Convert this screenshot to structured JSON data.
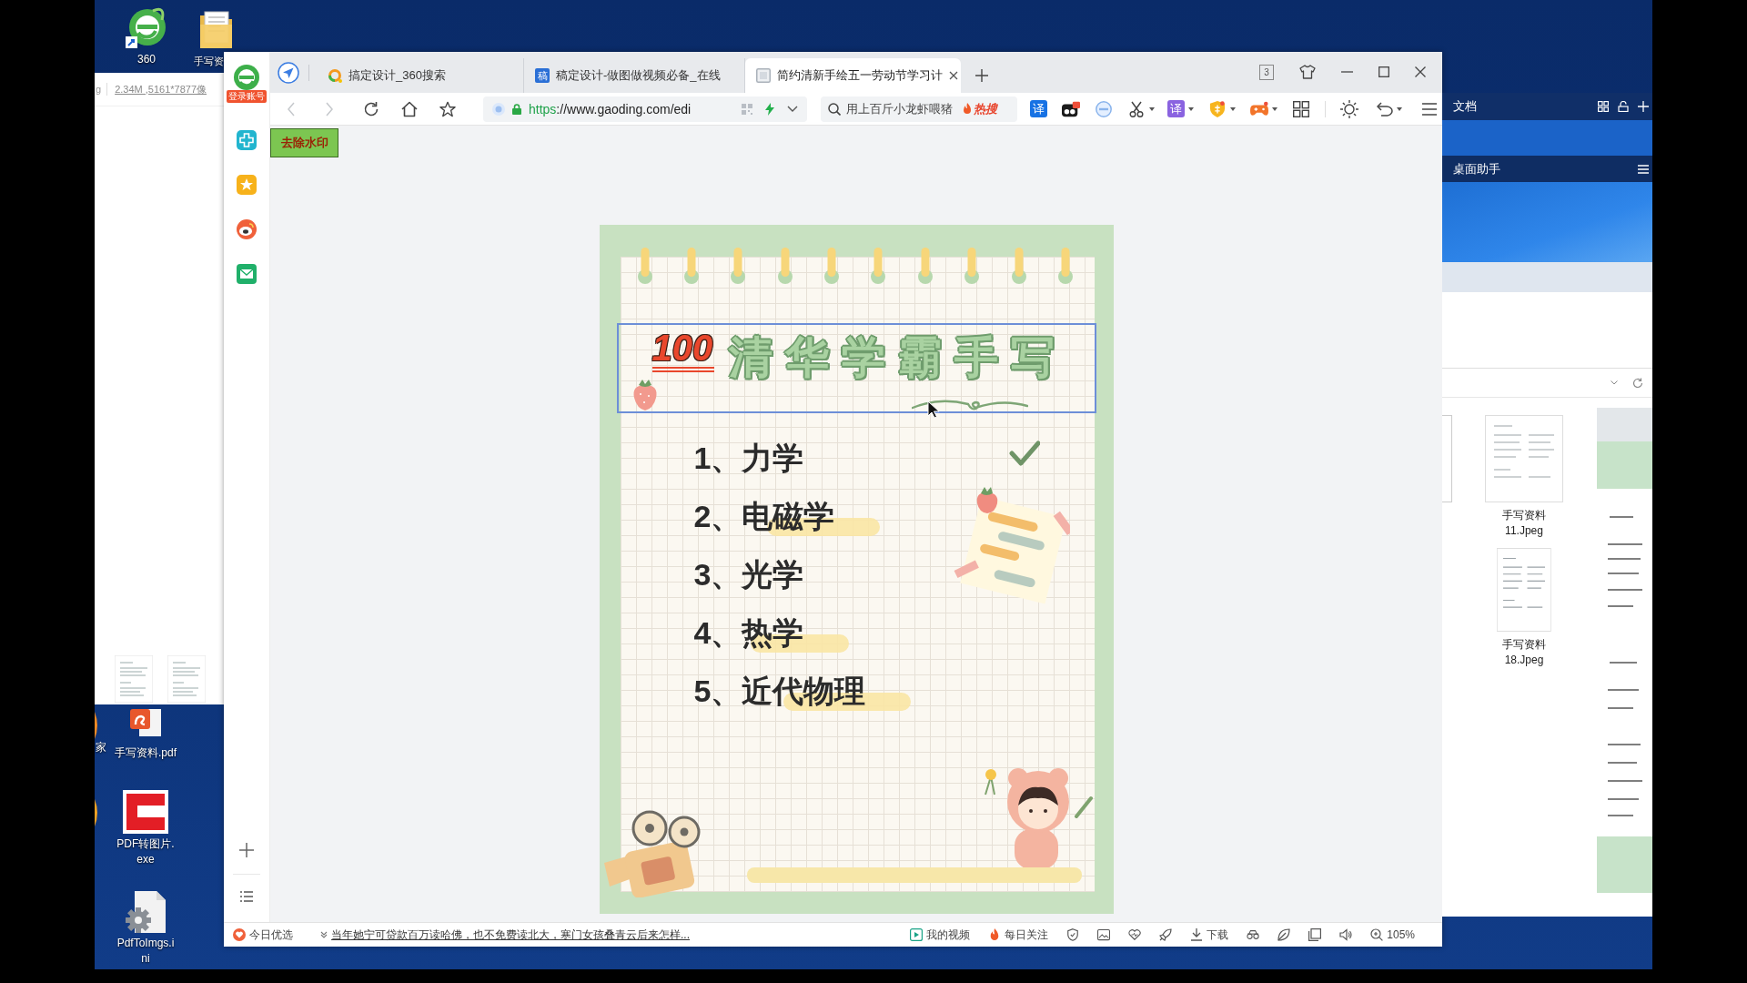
{
  "desktop": {
    "top_icons": [
      {
        "label": "360",
        "kind": "browser"
      },
      {
        "label": "手写资",
        "kind": "folder"
      }
    ],
    "bottom_icons": [
      {
        "label": "手写资料.pdf",
        "kind": "pdf"
      },
      {
        "label": "PDF转图片.exe",
        "kind": "exe"
      },
      {
        "label": "PdfToImgs.ini",
        "kind": "ini"
      }
    ],
    "edge_label": "家"
  },
  "viewer_window": {
    "path_fragment": "g",
    "file_info": "2.34M ,5161*7877像"
  },
  "browser": {
    "login_badge": "登录账号",
    "tabs": [
      {
        "title": "搞定设计_360搜索",
        "kind": "search",
        "selected": false
      },
      {
        "title": "稿定设计-做图做视频必备_在线",
        "kind": "site",
        "logo_text": "稿",
        "selected": false
      },
      {
        "title": "简约清新手绘五一劳动节学习计",
        "kind": "page",
        "selected": true
      }
    ],
    "tab_count": "3",
    "nav": {
      "back_disabled": true,
      "forward_disabled": true
    },
    "address": {
      "scheme": "https",
      "rest": "://www.gaoding.com/edi"
    },
    "search": {
      "placeholder": "用上百斤小龙虾喂猪",
      "hot_label": "热搜"
    },
    "extensions": [
      {
        "kind": "translate",
        "label": "译",
        "dropdown": false
      },
      {
        "kind": "mask",
        "dropdown": false
      },
      {
        "kind": "blocker",
        "dropdown": false
      },
      {
        "kind": "scissors",
        "dropdown": true
      },
      {
        "kind": "translate-alt",
        "label": "译",
        "dropdown": true
      },
      {
        "kind": "shield",
        "dropdown": true
      },
      {
        "kind": "gamepad",
        "dropdown": true
      },
      {
        "kind": "grid",
        "dropdown": false
      }
    ],
    "watermark_button": "去除水印",
    "poster": {
      "badge": "100",
      "title": "清华学霸手写",
      "title_selected": true,
      "items": [
        {
          "text": "1、力学",
          "checked": true,
          "highlight": false
        },
        {
          "text": "2、电磁学",
          "checked": false,
          "highlight": true
        },
        {
          "text": "3、光学",
          "checked": false,
          "highlight": false
        },
        {
          "text": "4、热学",
          "checked": false,
          "highlight": true
        },
        {
          "text": "5、近代物理",
          "checked": false,
          "highlight": true
        }
      ]
    },
    "status_bar": {
      "left_label": "今日优选",
      "headline": "当年她宁可贷款百万读哈佛，也不免费读北大，寒门女孩叠青云后来怎样...",
      "video_label": "我的视频",
      "follow_label": "每日关注",
      "download_label": "下载",
      "zoom": "105%"
    }
  },
  "side_window": {
    "title": "文档",
    "panel_title": "桌面助手",
    "files": [
      {
        "name": "手写资料11.Jpeg"
      },
      {
        "name": "手写资料18.Jpeg"
      }
    ]
  }
}
